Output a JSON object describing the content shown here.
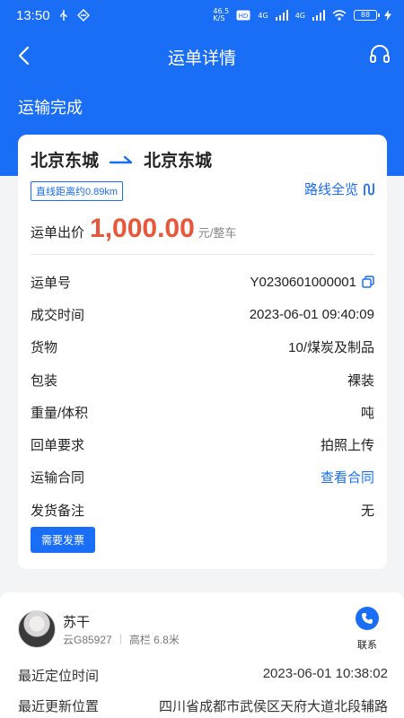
{
  "statusbar": {
    "time": "13:50",
    "network_top": "46.5",
    "network_bottom": "K/S",
    "signal_a": "4G",
    "signal_b": "4G",
    "battery": "88"
  },
  "navbar": {
    "title": "运单详情"
  },
  "order_status": "运输完成",
  "route": {
    "from": "北京东城",
    "to": "北京东城",
    "distance_tag": "直线距离约0.89km",
    "overview_label": "路线全览"
  },
  "price": {
    "label": "运单出价",
    "value": "1,000.00",
    "unit": "元/整车"
  },
  "details": [
    {
      "label": "运单号",
      "value": "Y0230601000001"
    },
    {
      "label": "成交时间",
      "value": "2023-06-01 09:40:09"
    },
    {
      "label": "货物",
      "value": "10/煤炭及制品"
    },
    {
      "label": "包装",
      "value": "裸装"
    },
    {
      "label": "重量/体积",
      "value": "吨"
    },
    {
      "label": "回单要求",
      "value": "拍照上传"
    },
    {
      "label": "运输合同",
      "value": "查看合同"
    },
    {
      "label": "发货备注",
      "value": "无"
    }
  ],
  "invoice_button": "需要发票",
  "driver": {
    "name": "苏干",
    "plate": "云G85927",
    "vehicle": "高栏 6.8米",
    "contact_label": "联系"
  },
  "location": {
    "time_label": "最近定位时间",
    "time_value": "2023-06-01 10:38:02",
    "place_label": "最近更新位置",
    "place_value": "四川省成都市武侯区天府大道北段辅路"
  },
  "colors": {
    "primary": "#1a6ef5",
    "price": "#e8573a"
  }
}
